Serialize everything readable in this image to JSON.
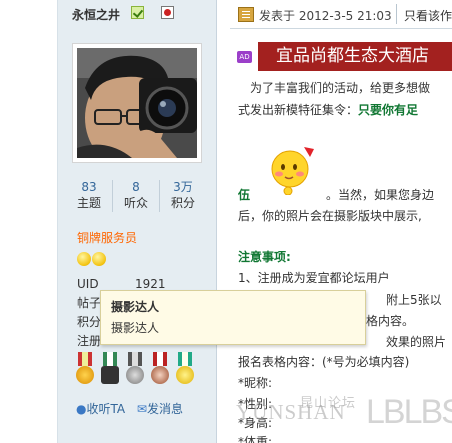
{
  "user": {
    "name": "永恒之井",
    "posts_label": "主题",
    "posts": "83",
    "listeners_label": "听众",
    "listeners": "8",
    "points_label": "积分",
    "points": "3万",
    "rank": "铜牌服务员",
    "uid_label": "UID",
    "uid": "1921",
    "row2_label": "帖子",
    "row3_label": "积分",
    "row4_label": "注册"
  },
  "tooltip": {
    "title": "摄影达人",
    "desc": "摄影达人"
  },
  "actions": {
    "listen": "收听TA",
    "message": "发消息"
  },
  "post": {
    "posted_at": "发表于  2012-3-5 21:03",
    "view_only": "只看该作"
  },
  "ad": {
    "badge": "AD",
    "banner": "宜品尚都生态大酒店"
  },
  "content": {
    "line1": "为了丰富我们的活动，给更多想做",
    "line2a": "式发出新模特征集令：",
    "line2b": "只要你有足",
    "line3a": "伍",
    "line3b": "。当然，如果您身边",
    "line4": "后，你的照片会在摄影版块中展示,",
    "notice_title": "注意事项:",
    "item1": "1、注册成为爱宜都论坛用户",
    "item2": "附上5张以",
    "item3": "格内容。",
    "item4": "效果的照片",
    "form_title": "报名表格内容：(*号为必填内容)",
    "field1": "*昵称:",
    "field2": "*性别:",
    "field3": "*身高:",
    "field4": "*体重:"
  },
  "watermark": {
    "text": "YUNSHAN",
    "logo": "LBLBS",
    "cn": "昆山论坛"
  },
  "colors": {
    "banner": "#a3211f",
    "rank": "#ff6600",
    "link": "#336699",
    "notice": "#117733"
  }
}
